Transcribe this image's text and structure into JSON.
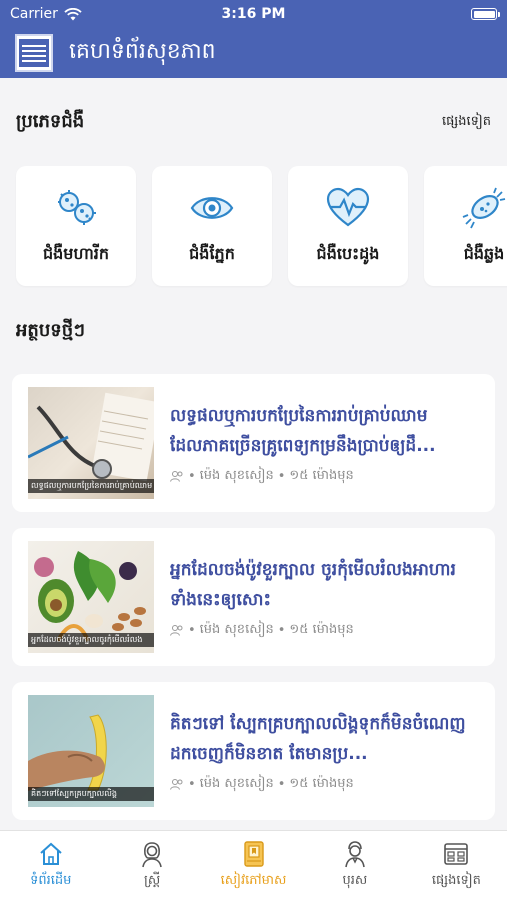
{
  "status": {
    "carrier": "Carrier",
    "time": "3:16 PM"
  },
  "header": {
    "title": "គេហទំព័រសុខភាព"
  },
  "categories_section": {
    "title": "ប្រភេទជំងឺ",
    "see_more": "ផ្សេងទៀត",
    "items": [
      {
        "label": "ជំងឺមហារីក",
        "icon": "virus-icon"
      },
      {
        "label": "ជំងឺភ្នែក",
        "icon": "eye-icon"
      },
      {
        "label": "ជំងឺបេះដូង",
        "icon": "heart-pulse-icon"
      },
      {
        "label": "ជំងឺឆ្លង",
        "icon": "bacteria-icon"
      }
    ]
  },
  "articles_section": {
    "title": "អត្ថបទថ្មីៗ",
    "items": [
      {
        "title": "លទ្ធផលឬការបកប្រែនៃការរាប់គ្រាប់ឈាមដែលភាគច្រើនគ្រូពេទ្យកម្រនឹងប្រាប់ឲ្យដឹ...",
        "author": "ម៉េង សុខសៀន",
        "time": "១៥ ម៉ោងមុន",
        "caption": "លទ្ធផលឬការបកប្រែនៃការរាប់គ្រាប់ឈាម"
      },
      {
        "title": "អ្នកដែលចង់ប៉ូវខួរក្បាល ចូរកុំមើលរំលងអាហារទាំងនេះឲ្យសោះ",
        "author": "ម៉េង សុខសៀន",
        "time": "១៥ ម៉ោងមុន",
        "caption": "អ្នកដែលចង់ប៉ូវខួរក្បាលចូរកុំមើលរំលង"
      },
      {
        "title": "គិតៗទៅ ស្បែកគ្របក្បាលលិង្គទុកក៏មិនចំណេញ ដកចេញក៏មិនខាត តែមានប្រ...",
        "author": "ម៉េង សុខសៀន",
        "time": "១៥ ម៉ោងមុន",
        "caption": "គិតៗទៅស្បែកគ្របក្បាលលិង្គ"
      }
    ]
  },
  "tabbar": {
    "items": [
      {
        "label": "ទំព័រដើម",
        "icon": "home-icon",
        "state": "active"
      },
      {
        "label": "ស្ត្រី",
        "icon": "woman-icon",
        "state": "normal"
      },
      {
        "label": "សៀវភៅមាស",
        "icon": "golden-book-icon",
        "state": "featured"
      },
      {
        "label": "បុរស",
        "icon": "man-icon",
        "state": "normal"
      },
      {
        "label": "ផ្សេងទៀត",
        "icon": "more-icon",
        "state": "normal"
      }
    ]
  },
  "colors": {
    "primary": "#4a63b4",
    "title_blue": "#3f4fa0",
    "active_tab": "#2a8fd6",
    "featured_tab": "#e8a01c",
    "icon_blue": "#2f86c9"
  }
}
